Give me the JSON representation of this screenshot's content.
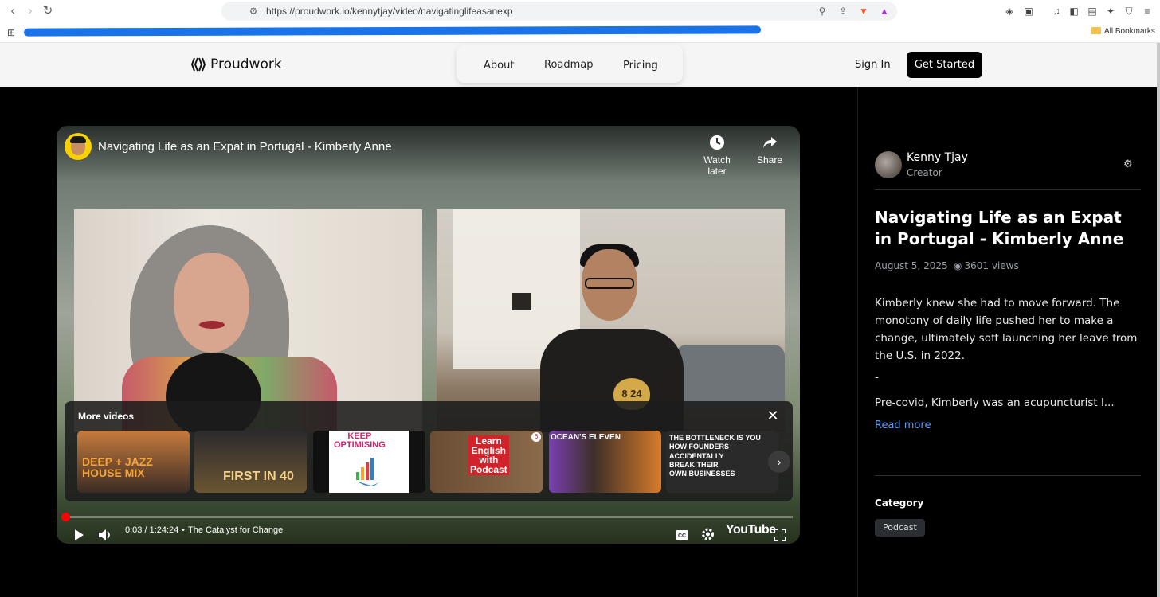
{
  "browser": {
    "url": "https://proudwork.io/kennytjay/video/navigatinglifeasanexp",
    "all_bookmarks": "All Bookmarks"
  },
  "site": {
    "logo": "Proudwork",
    "nav": [
      "About",
      "Roadmap",
      "Pricing"
    ],
    "sign_in": "Sign In",
    "get_started": "Get Started"
  },
  "player": {
    "title": "Navigating Life as an Expat in Portugal - Kimberly Anne",
    "watch_later": "Watch later",
    "share": "Share",
    "more_videos": "More videos",
    "thumbnails": [
      {
        "text": "DEEP + JAZZ\nHOUSE MIX",
        "colors": [
          "#d9803a",
          "#3b2b24"
        ]
      },
      {
        "text": "FIRST IN 40",
        "colors": [
          "#2c2a2e",
          "#b08b4e"
        ]
      },
      {
        "text": "KEEP\nOPTIMISING",
        "colors": [
          "#ffffff",
          "#1f63a8"
        ]
      },
      {
        "text": "Learn\nEnglish\nwith\nPodcast",
        "badge": "6",
        "colors": [
          "#6b4d34",
          "#e8b33b"
        ]
      },
      {
        "text": "OCEAN'S ELEVEN",
        "colors": [
          "#3d2f28",
          "#d87b2a"
        ]
      },
      {
        "text": "THE BOTTLENECK IS YOU\nHOW FOUNDERS\nACCIDENTALLY\nBREAK THEIR\nOWN BUSINESSES",
        "colors": [
          "#2a2a2a",
          "#d83a2f"
        ]
      }
    ],
    "progress": 0.0006,
    "time": "0:03 / 1:24:24",
    "chapter_sep": "•",
    "chapter": "The Catalyst for Change",
    "yt_logo": "YouTube",
    "woman_badge": "8 24"
  },
  "sidebar": {
    "creator_name": "Kenny Tjay",
    "creator_role": "Creator",
    "title": "Navigating Life as an Expat in Portugal - Kimberly Anne",
    "date": "August 5, 2025",
    "views": "3601 views",
    "description": "Kimberly knew she had to move forward. The monotony of daily life pushed her to make a change, ultimately soft launching her leave from the U.S. in 2022.",
    "dash": "-",
    "description2": "Pre-covid, Kimberly was an acupuncturist l...",
    "read_more": "Read more",
    "category_heading": "Category",
    "category": "Podcast"
  }
}
